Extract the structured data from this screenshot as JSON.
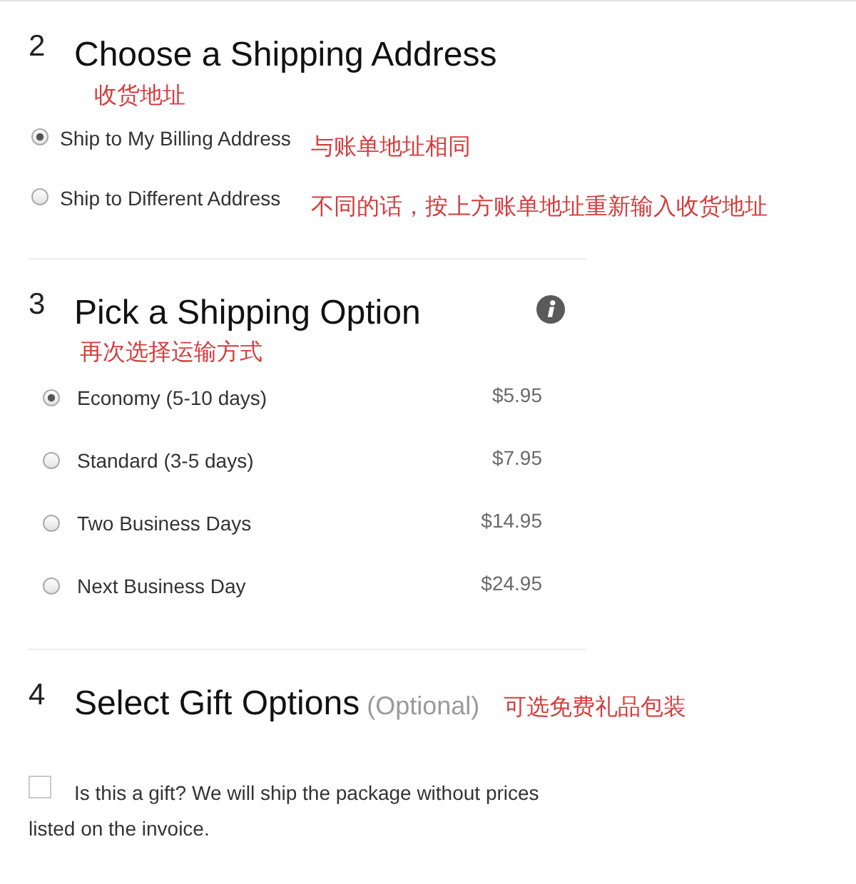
{
  "shipping_address": {
    "number": "2",
    "title": "Choose a Shipping Address",
    "note": "收货地址",
    "options": [
      {
        "label": "Ship to My Billing Address",
        "selected": true,
        "note": "与账单地址相同"
      },
      {
        "label": "Ship to Different Address",
        "selected": false,
        "note": "不同的话，按上方账单地址重新输入收货地址"
      }
    ]
  },
  "shipping_option": {
    "number": "3",
    "title": "Pick a Shipping Option",
    "note": "再次选择运输方式",
    "options": [
      {
        "label": "Economy (5-10 days)",
        "price": "$5.95",
        "selected": true
      },
      {
        "label": "Standard (3-5 days)",
        "price": "$7.95",
        "selected": false
      },
      {
        "label": "Two Business Days",
        "price": "$14.95",
        "selected": false
      },
      {
        "label": "Next Business Day",
        "price": "$24.95",
        "selected": false
      }
    ]
  },
  "gift_options": {
    "number": "4",
    "title": "Select Gift Options",
    "subtitle": "(Optional)",
    "note": "可选免费礼品包装",
    "gift": {
      "label": "Is this a gift? We will ship the package without prices listed on the invoice.",
      "checked": false
    }
  }
}
